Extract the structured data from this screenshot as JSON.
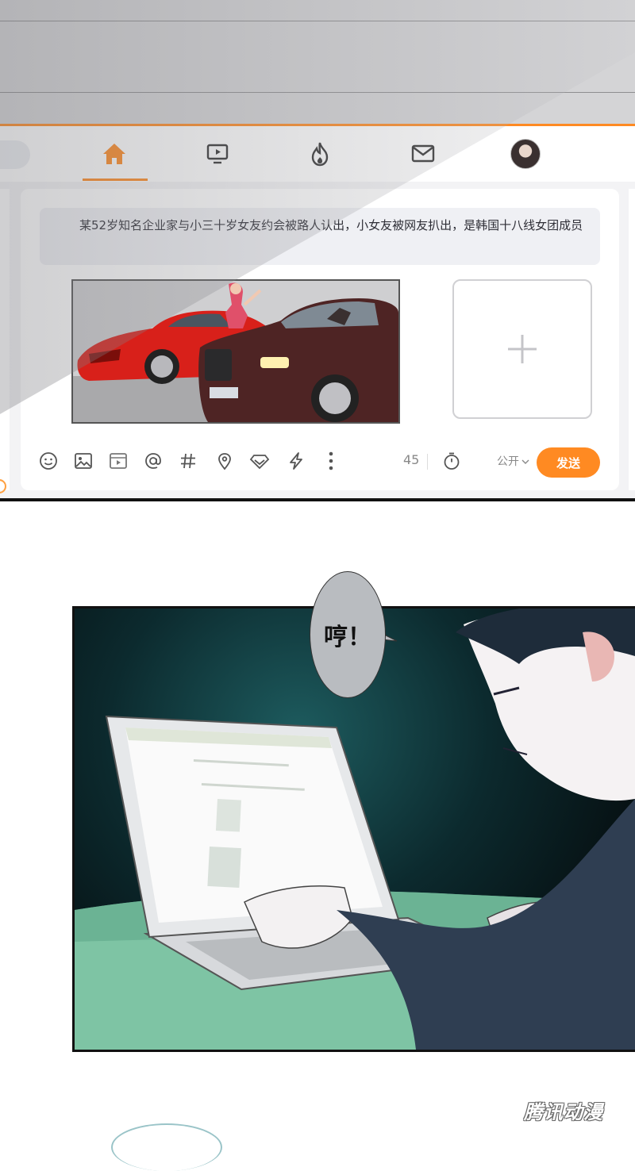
{
  "nav": {
    "tabs": [
      {
        "name": "home",
        "icon": "home-icon",
        "active": true
      },
      {
        "name": "video",
        "icon": "tv-play-icon"
      },
      {
        "name": "hot",
        "icon": "flame-icon"
      },
      {
        "name": "messages",
        "icon": "mail-icon"
      },
      {
        "name": "profile",
        "icon": "avatar"
      }
    ],
    "accent_color": "#ff8a22"
  },
  "composer": {
    "post_text": "某52岁知名企业家与小三十岁女友约会被路人认出，小女友被网友扒出，是韩国十八线女团成员",
    "attached_image": "red-sports-car-and-dark-luxury-sedan-illustration",
    "add_image_icon": "plus-icon",
    "toolbar_icons": [
      "emoji-icon",
      "image-icon",
      "video-icon",
      "at-icon",
      "hashtag-icon",
      "location-icon",
      "diamond-icon",
      "lightning-icon",
      "more-icon"
    ],
    "char_count": "45",
    "schedule_icon": "timer-icon",
    "visibility_label": "公开",
    "send_label": "发送"
  },
  "panel2": {
    "speech": "哼！",
    "scene": "man-typing-on-laptop-in-dark-room"
  },
  "watermark": "腾讯动漫"
}
